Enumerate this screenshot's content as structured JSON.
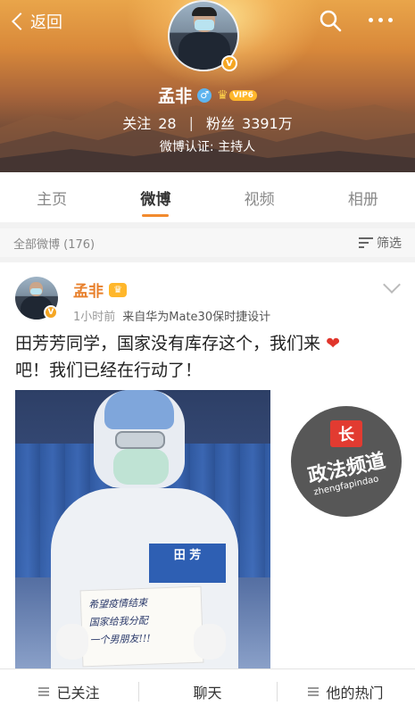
{
  "header": {
    "back_label": "返回",
    "username": "孟非",
    "gender_symbol": "♂",
    "verified_badge": "V",
    "vip_level": "VIP6",
    "following_label": "关注",
    "following_count": "28",
    "followers_label": "粉丝",
    "followers_count": "3391万",
    "verification": "微博认证: 主持人"
  },
  "tabs": [
    {
      "label": "主页",
      "active": false
    },
    {
      "label": "微博",
      "active": true
    },
    {
      "label": "视频",
      "active": false
    },
    {
      "label": "相册",
      "active": false
    }
  ],
  "feed_bar": {
    "all_posts": "全部微博 (176)",
    "filter_label": "筛选"
  },
  "post": {
    "author": "孟非",
    "time": "1小时前",
    "source": "来自华为Mate30保时捷设计",
    "text_line1": "田芳芳同学，国家没有库存这个，我们来",
    "heart": "❤",
    "text_line2": "吧！我们已经在行动了！",
    "image": {
      "name_tag": "田 芳",
      "sign_line1": "希望疫情结束",
      "sign_line2": "国家给我分配",
      "sign_line3": "一个男朋友!!!"
    }
  },
  "watermark": {
    "logo": "长",
    "title": "政法频道",
    "subtitle": "zhengfapindao"
  },
  "bottom_bar": {
    "followed": "已关注",
    "chat": "聊天",
    "hot": "他的热门"
  },
  "colors": {
    "accent": "#f28a2e",
    "author_name": "#e8802c",
    "vip": "#ffb72b"
  }
}
